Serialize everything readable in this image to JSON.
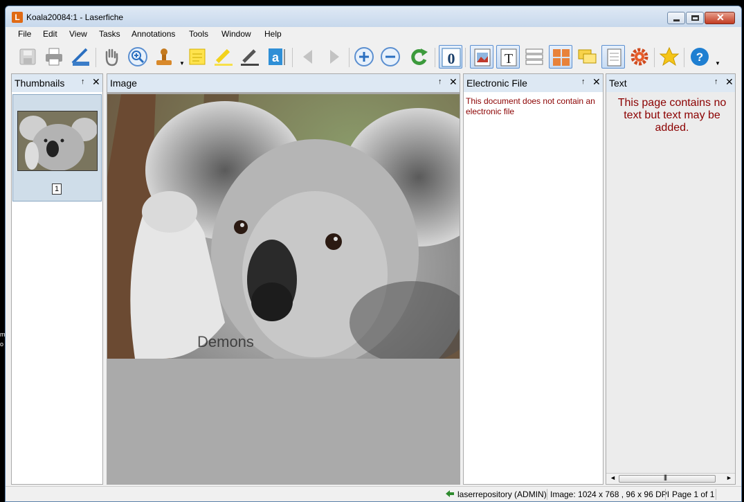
{
  "window": {
    "title": "Koala20084:1 - Laserfiche",
    "app_icon_letter": "L"
  },
  "menu": [
    "File",
    "Edit",
    "View",
    "Tasks",
    "Annotations",
    "Tools",
    "Window",
    "Help"
  ],
  "toolbar": {
    "icons": [
      "save-icon",
      "print-icon",
      "scanner-icon",
      "hand-icon",
      "zoom-in-icon",
      "stamp-icon",
      "sticky-note-icon",
      "highlighter-icon",
      "pen-icon",
      "text-box-icon",
      "previous-page-icon",
      "next-page-icon",
      "zoom-plus-icon",
      "zoom-minus-icon",
      "refresh-icon",
      "ocr-icon",
      "image-view-icon",
      "text-view-icon",
      "metadata-icon",
      "thumbnails-view-icon",
      "annotations-view-icon",
      "electronic-file-icon",
      "settings-icon",
      "favorites-icon",
      "help-icon"
    ],
    "ocr_letter": "0",
    "text_letter": "T",
    "textbox_letter": "a",
    "help_glyph": "?"
  },
  "panels": {
    "thumbnails": {
      "title": "Thumbnails",
      "page_number": "1"
    },
    "image": {
      "title": "Image",
      "watermark": "Demons"
    },
    "electronic_file": {
      "title": "Electronic File",
      "message": "This document does not contain an electronic file"
    },
    "text": {
      "title": "Text",
      "message": "This page contains no text but text may be added."
    }
  },
  "pane_controls": {
    "pin": "↑",
    "close": "✕"
  },
  "scrollbar": {
    "left": "◄",
    "right": "►",
    "grip": "|||"
  },
  "status": {
    "repository": "laserrepository (ADMIN)",
    "image_info": "Image: 1024 x 768 , 96 x 96 DPI",
    "page": "Page 1 of 1"
  },
  "edge_text": [
    "m",
    "o"
  ],
  "colors": {
    "accent": "#e06a14",
    "message_red": "#8b0000",
    "header_blue": "#dde8f3",
    "selection_blue": "#5b8fd0"
  }
}
